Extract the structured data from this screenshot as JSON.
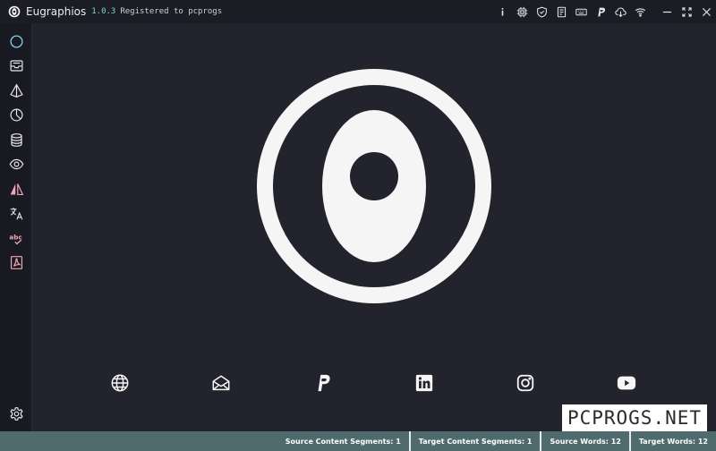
{
  "window": {
    "title": "Eugraphios",
    "version": "1.0.3",
    "registered": "Registered to pcprogs",
    "toolbar_icons": [
      "info-icon",
      "chip-icon",
      "shield-icon",
      "document-icon",
      "keyboard-icon",
      "paypal-icon",
      "cloud-download-icon",
      "wifi-icon"
    ],
    "controls": [
      "minimize",
      "fullscreen",
      "close"
    ]
  },
  "sidebar": {
    "items": [
      {
        "icon": "circle-icon",
        "color": "#7fd6f0"
      },
      {
        "icon": "inbox-icon",
        "color": "#e6e6e6"
      },
      {
        "icon": "prism-icon",
        "color": "#e6e6e6"
      },
      {
        "icon": "pie-chart-icon",
        "color": "#e6e6e6"
      },
      {
        "icon": "database-icon",
        "color": "#e6e6e6"
      },
      {
        "icon": "eye-icon",
        "color": "#e6e6e6"
      },
      {
        "icon": "mirror-icon",
        "color": "#f0a6b8"
      },
      {
        "icon": "translate-icon",
        "color": "#e6e6e6"
      },
      {
        "icon": "spellcheck-icon",
        "color": "#f0a6b8"
      },
      {
        "icon": "pdf-icon",
        "color": "#f0a6b8"
      }
    ],
    "settings_icon": "gear-icon"
  },
  "main": {
    "logo": "eugraphios-logo",
    "social_links": [
      "globe-icon",
      "mail-icon",
      "paypal-icon",
      "linkedin-icon",
      "instagram-icon",
      "youtube-icon"
    ]
  },
  "statusbar": {
    "source_segments": "Source Content Segments: 1",
    "target_segments": "Target Content Segments: 1",
    "source_words": "Source Words: 12",
    "target_words": "Target Words: 12"
  },
  "watermark": "PCPROGS.NET",
  "colors": {
    "background": "#22232d",
    "sidebar": "#191a21",
    "statusbar": "#4f6b6d",
    "accent": "#7fd6f0",
    "pink": "#f0a6b8"
  }
}
